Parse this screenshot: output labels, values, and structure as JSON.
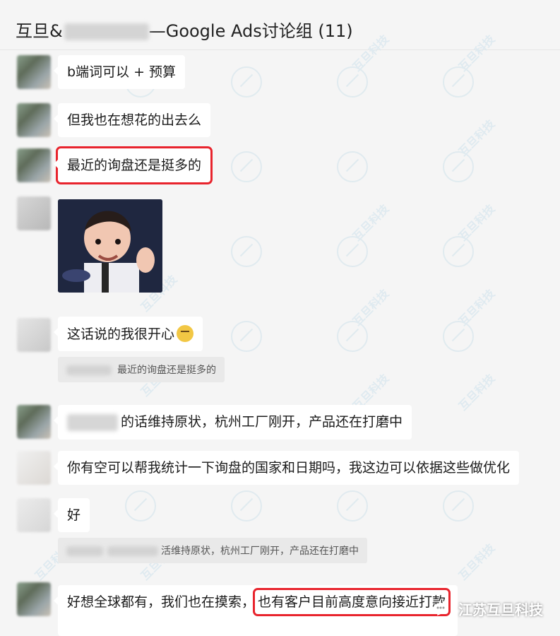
{
  "header": {
    "title_prefix": "互旦&",
    "title_suffix": "—Google Ads讨论组 (11)"
  },
  "messages": [
    {
      "text": "b端词可以 + 预算"
    },
    {
      "text": "但我也在想花的出去么"
    },
    {
      "text": "最近的询盘还是挺多的",
      "highlight": true
    },
    {
      "type": "image"
    },
    {
      "text": "这话说的我很开心"
    },
    {
      "quote": "最近的询盘还是挺多的"
    },
    {
      "text_suffix": "的话维持原状，杭州工厂刚开，产品还在打磨中"
    },
    {
      "text": "你有空可以帮我统计一下询盘的国家和日期吗，我这边可以依据这些做优化"
    },
    {
      "text": "好"
    },
    {
      "quote": "活维持原状，杭州工厂刚开，产品还在打磨中"
    },
    {
      "text_part1": "好想全球都有，我们也在摸索，",
      "text_part2": "也有客户目前高度意向接近打款"
    }
  ],
  "watermark": {
    "line1": "互旦科技",
    "line2": "HUDDO"
  },
  "brand": {
    "label": "江苏互旦科技",
    "icon": "wechat-like-icon"
  },
  "colors": {
    "highlight": "#e8242d",
    "background": "#f5f5f5",
    "bubble": "#ffffff"
  }
}
